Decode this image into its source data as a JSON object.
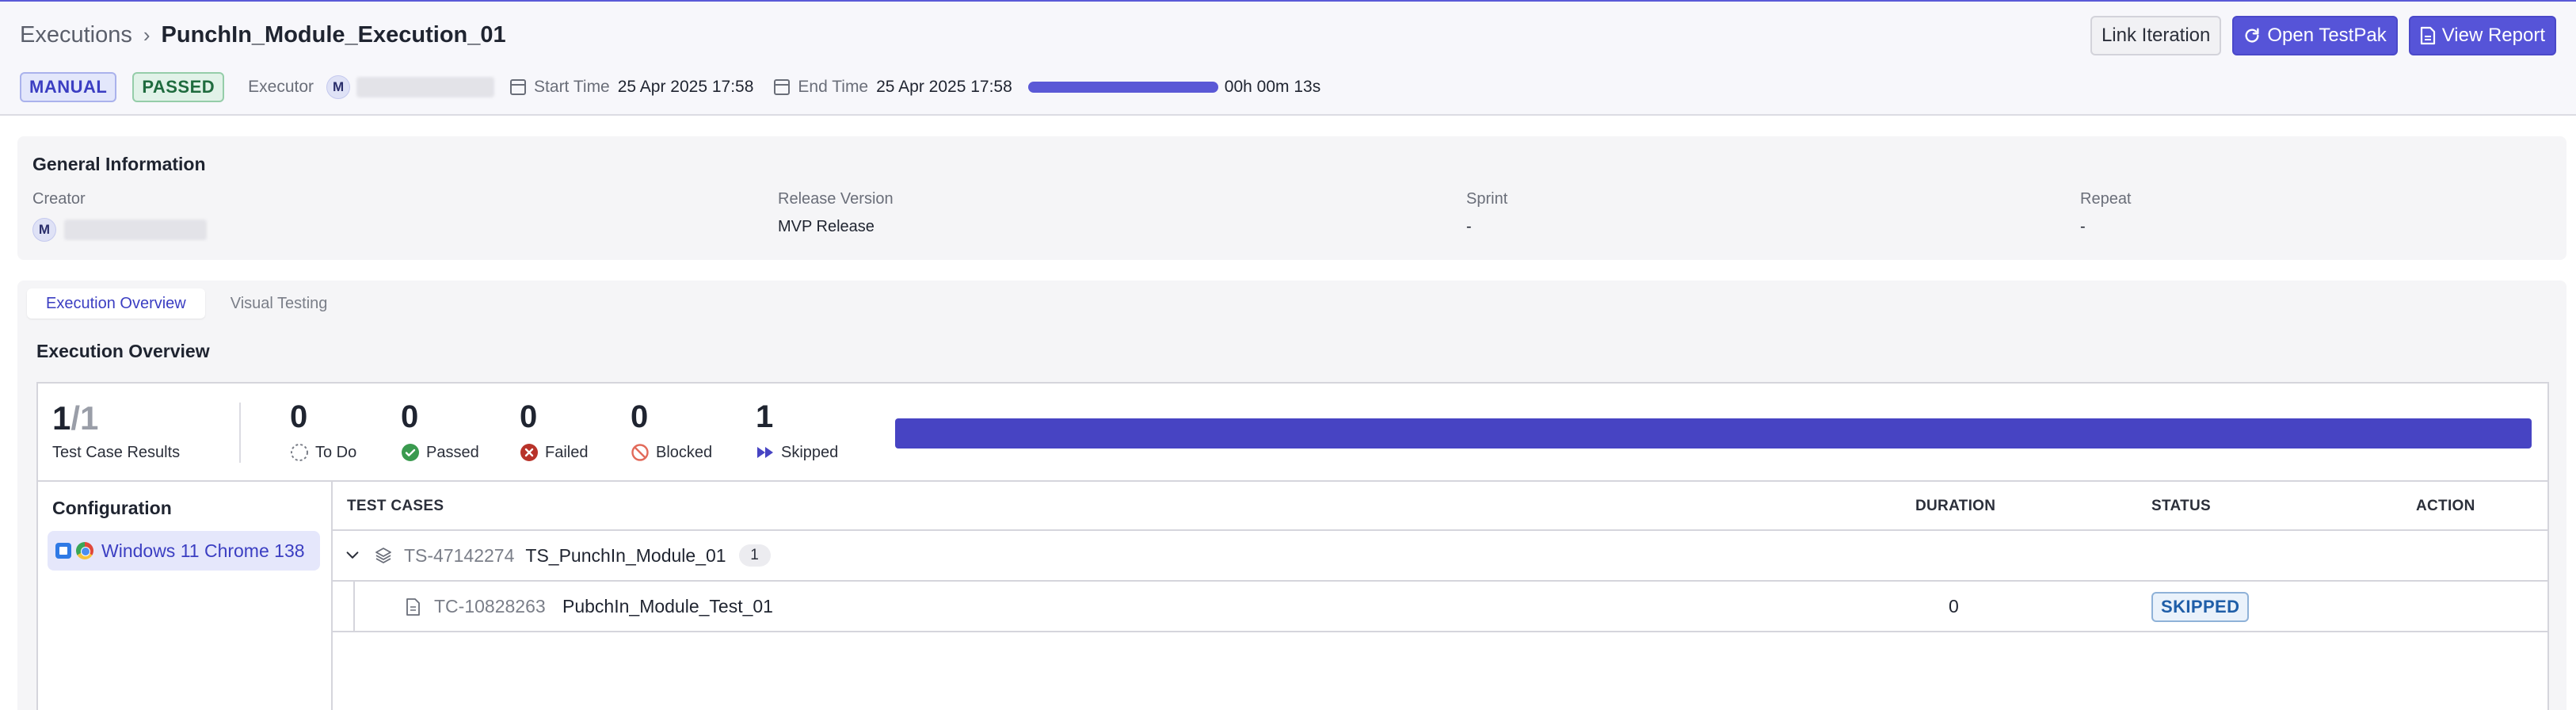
{
  "breadcrumb": {
    "root": "Executions",
    "separator": "›",
    "title": "PunchIn_Module_Execution_01"
  },
  "header": {
    "type_badge": "MANUAL",
    "result_badge": "PASSED",
    "executor_label": "Executor",
    "executor_initial": "M",
    "start_label": "Start Time",
    "start_value": "25 Apr 2025 17:58",
    "end_label": "End Time",
    "end_value": "25 Apr 2025 17:58",
    "progress_fraction": 1.0,
    "duration": "00h 00m 13s"
  },
  "actions": {
    "link_iteration": "Link Iteration",
    "open_testpak": "Open TestPak",
    "view_report": "View Report"
  },
  "general": {
    "title": "General Information",
    "creator_label": "Creator",
    "creator_initial": "M",
    "release_label": "Release Version",
    "release_value": "MVP Release",
    "sprint_label": "Sprint",
    "sprint_value": "-",
    "repeat_label": "Repeat",
    "repeat_value": "-"
  },
  "tabs": [
    {
      "label": "Execution Overview",
      "active": true
    },
    {
      "label": "Visual Testing",
      "active": false
    }
  ],
  "overview": {
    "title": "Execution Overview",
    "total_done": "1",
    "total_all": "/1",
    "total_label": "Test Case Results",
    "stats": [
      {
        "value": "0",
        "label": "To Do",
        "icon": "todo-icon"
      },
      {
        "value": "0",
        "label": "Passed",
        "icon": "passed-icon"
      },
      {
        "value": "0",
        "label": "Failed",
        "icon": "failed-icon"
      },
      {
        "value": "0",
        "label": "Blocked",
        "icon": "blocked-icon"
      },
      {
        "value": "1",
        "label": "Skipped",
        "icon": "skipped-icon"
      }
    ],
    "skipped_fraction": 1.0,
    "colors": {
      "skipped": "#4744c3",
      "accent": "#5654d8",
      "passed": "#3a9a4f",
      "failed": "#c0392b",
      "blocked": "#e26a5a"
    }
  },
  "configuration": {
    "title": "Configuration",
    "item": "Windows 11 Chrome 138"
  },
  "table": {
    "headers": {
      "test_cases": "TEST CASES",
      "duration": "DURATION",
      "status": "STATUS",
      "action": "ACTION"
    },
    "suite": {
      "id": "TS-47142274",
      "name": "TS_PunchIn_Module_01",
      "count": "1"
    },
    "case": {
      "id": "TC-10828263",
      "name": "PubchIn_Module_Test_01",
      "duration": "0",
      "status": "SKIPPED"
    }
  }
}
